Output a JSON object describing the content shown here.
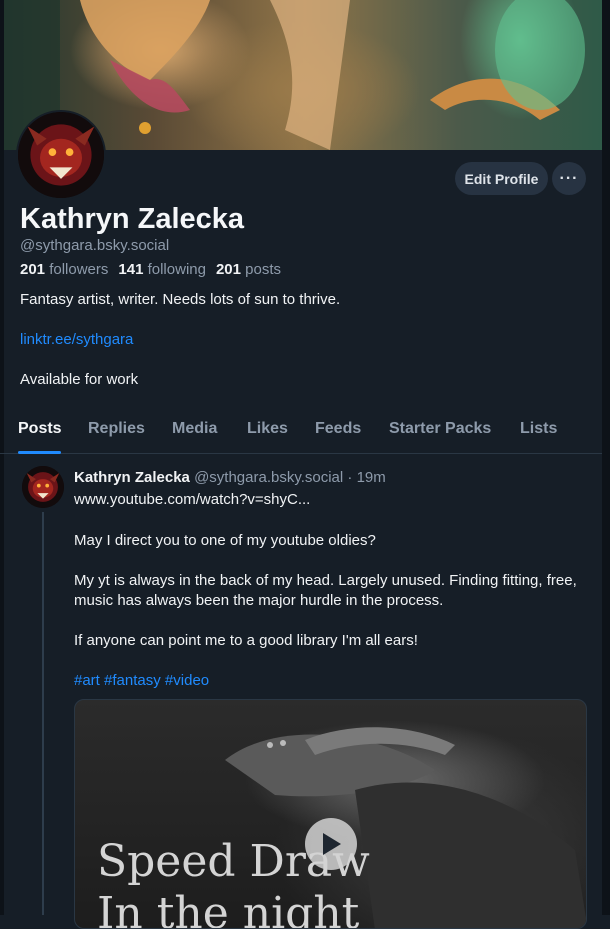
{
  "profile": {
    "name": "Kathryn Zalecka",
    "handle": "@sythgara.bsky.social",
    "followers_count": "201",
    "followers_label": "followers",
    "following_count": "141",
    "following_label": "following",
    "posts_count": "201",
    "posts_label": "posts",
    "bio_line1": "Fantasy artist, writer. Needs lots of sun to thrive.",
    "bio_link": "linktr.ee/sythgara",
    "bio_line3": "Available for work",
    "edit_button": "Edit Profile",
    "more_button": "···"
  },
  "tabs": [
    {
      "label": "Posts",
      "active": true
    },
    {
      "label": "Replies"
    },
    {
      "label": "Media"
    },
    {
      "label": "Likes"
    },
    {
      "label": "Feeds"
    },
    {
      "label": "Starter Packs"
    },
    {
      "label": "Lists"
    }
  ],
  "post": {
    "author": "Kathryn Zalecka",
    "handle": "@sythgara.bsky.social",
    "time": "· 19m",
    "link": "www.youtube.com/watch?v=shyC...",
    "paragraph1": "May I direct you to one of my youtube oldies?",
    "paragraph2": "My yt is always in the back of my head. Largely unused. Finding fitting, free, music has always been the major hurdle in the process.",
    "paragraph3": "If anyone can point me to a good library I'm all ears!",
    "hashtags": [
      "#art",
      "#fantasy",
      "#video"
    ],
    "embed_title_line1": "Speed Draw",
    "embed_title_line2": "In the night"
  },
  "colors": {
    "background": "#161e27",
    "accent": "#208bfe",
    "muted_text": "#8e9bab"
  },
  "icons": {
    "more": "ellipsis-icon",
    "play": "play-icon"
  }
}
